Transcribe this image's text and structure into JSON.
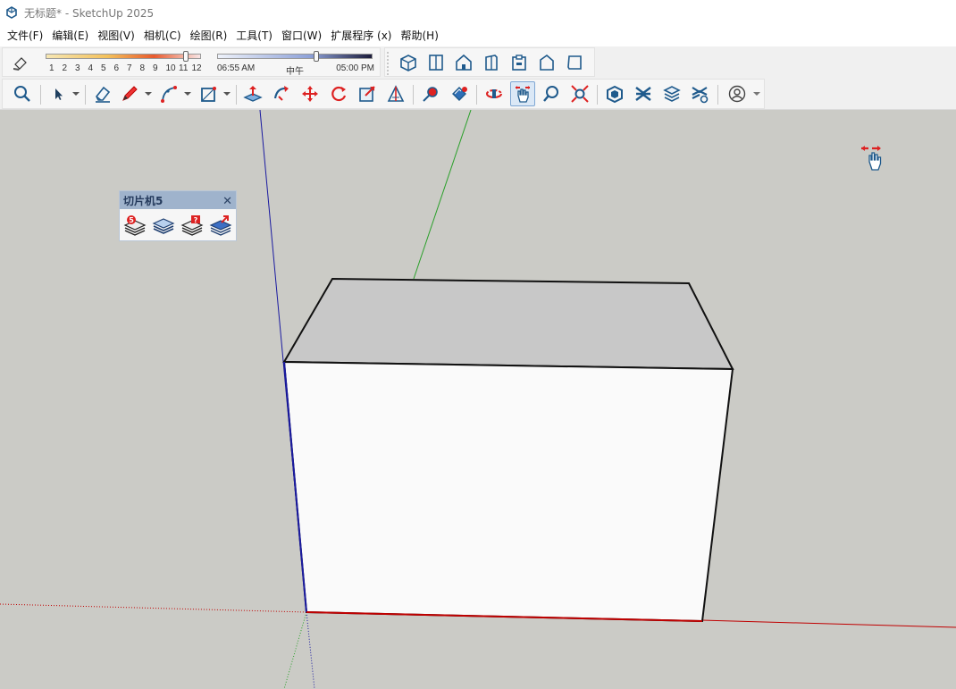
{
  "window": {
    "title": "无标题* - SketchUp 2025",
    "app_icon": "sketchup-logo-icon"
  },
  "menu": [
    {
      "label": "文件(F)"
    },
    {
      "label": "编辑(E)"
    },
    {
      "label": "视图(V)"
    },
    {
      "label": "相机(C)"
    },
    {
      "label": "绘图(R)"
    },
    {
      "label": "工具(T)"
    },
    {
      "label": "窗口(W)"
    },
    {
      "label": "扩展程序 (x)"
    },
    {
      "label": "帮助(H)"
    }
  ],
  "shadows": {
    "month_ticks": [
      "1",
      "2",
      "3",
      "4",
      "5",
      "6",
      "7",
      "8",
      "9",
      "10",
      "11",
      "12"
    ],
    "month_value": 11,
    "time_start": "06:55 AM",
    "time_mid": "中午",
    "time_end": "05:00 PM",
    "time_value_fraction": 0.64
  },
  "views_toolbar": [
    "iso-view-icon",
    "top-view-icon",
    "front-view-icon",
    "right-view-icon",
    "back-view-icon",
    "left-view-icon",
    "bottom-view-icon"
  ],
  "main_toolbar": [
    "zoom-icon",
    "select-icon",
    "eraser-icon",
    "pencil-icon",
    "arc-icon",
    "rectangle-icon",
    "push-pull-icon",
    "follow-me-icon",
    "move-icon",
    "rotate-icon",
    "scale-icon",
    "offset-icon",
    "tape-measure-icon",
    "paint-bucket-icon",
    "orbit-icon",
    "pan-icon",
    "zoom-window-icon",
    "zoom-extents-icon",
    "component-icon",
    "section-icon",
    "layers-icon",
    "solid-tools-icon",
    "account-icon"
  ],
  "active_tool": "pan-icon",
  "floating_toolbar": {
    "title": "切片机5",
    "icons": [
      "slicer-stack-icon",
      "slicer-layers-icon",
      "slicer-red-icon",
      "slicer-blue-icon"
    ]
  },
  "colors": {
    "viewport": "#cbcbc6",
    "box_top": "#c8c8c8",
    "box_front": "#fafafa",
    "axis_red": "#c00000",
    "axis_green": "#2aa02a",
    "axis_blue": "#1a1aa0",
    "toolbar_accent": "#1f5a8c"
  }
}
